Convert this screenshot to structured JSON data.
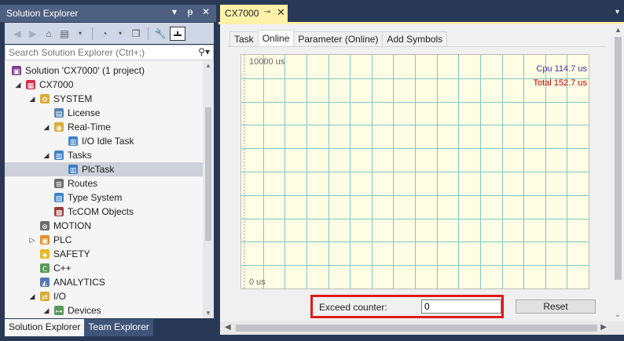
{
  "solution_explorer": {
    "title": "Solution Explorer",
    "title_buttons": [
      "▾",
      "ᵽ",
      "✕"
    ],
    "search_placeholder": "Search Solution Explorer (Ctrl+;)",
    "tree": [
      {
        "label": "Solution 'CX7000' (1 project)",
        "icon": "solution-icon",
        "depth": 0,
        "arrow": ""
      },
      {
        "label": "CX7000",
        "icon": "project-icon",
        "depth": 1,
        "arrow": "◢"
      },
      {
        "label": "SYSTEM",
        "icon": "system-icon",
        "depth": 2,
        "arrow": "◢"
      },
      {
        "label": "License",
        "icon": "license-icon",
        "depth": 3,
        "arrow": ""
      },
      {
        "label": "Real-Time",
        "icon": "realtime-icon",
        "depth": 3,
        "arrow": "◢"
      },
      {
        "label": "I/O Idle Task",
        "icon": "task-icon",
        "depth": 4,
        "arrow": ""
      },
      {
        "label": "Tasks",
        "icon": "tasks-icon",
        "depth": 3,
        "arrow": "◢"
      },
      {
        "label": "PlcTask",
        "icon": "task-icon",
        "depth": 4,
        "arrow": "",
        "selected": true
      },
      {
        "label": "Routes",
        "icon": "routes-icon",
        "depth": 3,
        "arrow": ""
      },
      {
        "label": "Type System",
        "icon": "type-system-icon",
        "depth": 3,
        "arrow": ""
      },
      {
        "label": "TcCOM Objects",
        "icon": "tccom-icon",
        "depth": 3,
        "arrow": ""
      },
      {
        "label": "MOTION",
        "icon": "motion-icon",
        "depth": 2,
        "arrow": ""
      },
      {
        "label": "PLC",
        "icon": "plc-icon",
        "depth": 2,
        "arrow": "▷"
      },
      {
        "label": "SAFETY",
        "icon": "safety-icon",
        "depth": 2,
        "arrow": ""
      },
      {
        "label": "C++",
        "icon": "cpp-icon",
        "depth": 2,
        "arrow": ""
      },
      {
        "label": "ANALYTICS",
        "icon": "analytics-icon",
        "depth": 2,
        "arrow": ""
      },
      {
        "label": "I/O",
        "icon": "io-icon",
        "depth": 2,
        "arrow": "◢"
      },
      {
        "label": "Devices",
        "icon": "devices-icon",
        "depth": 3,
        "arrow": "◢"
      }
    ],
    "bottom_tabs": [
      {
        "label": "Solution Explorer",
        "active": true
      },
      {
        "label": "Team Explorer",
        "active": false
      }
    ]
  },
  "document": {
    "tab_title": "CX7000",
    "inner_tabs": [
      {
        "label": "Task",
        "active": false
      },
      {
        "label": "Online",
        "active": true
      },
      {
        "label": "Parameter (Online)",
        "active": false
      },
      {
        "label": "Add Symbols",
        "active": false
      }
    ],
    "chart": {
      "top_label": "10000 us",
      "bottom_label": "0 us",
      "cpu_label": "Cpu 114.7 us",
      "total_label": "Total 152.7 us",
      "background_color": "#fffde4",
      "grid_color": "#7fc7c7",
      "cpu_color": "#4b2bb0",
      "total_color": "#c00000",
      "grid_columns": 16,
      "grid_rows": 10
    },
    "exceed_counter": {
      "label": "Exceed counter:",
      "value": "0",
      "highlight_color": "#e01b1b"
    },
    "reset_label": "Reset"
  },
  "colors": {
    "chrome_dark": "#293955",
    "title_bar": "#4d6082",
    "active_doc_tab": "#fff1a8"
  }
}
